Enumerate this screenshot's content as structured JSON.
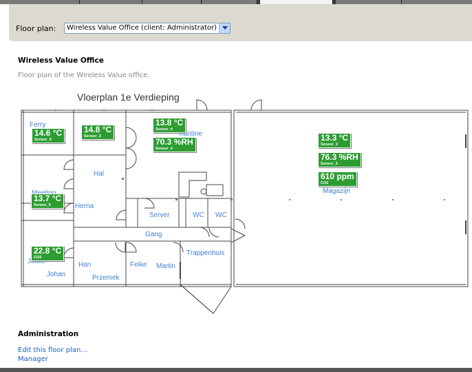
{
  "toolbar": {
    "floor_plan_label": "Floor plan:",
    "floor_plan_selected": "Wireless Value Office (client: Administrator)"
  },
  "page": {
    "title": "Wireless Value Office",
    "description": "Floor plan of the Wireless Value office."
  },
  "plan": {
    "title": "Vloerplan 1e Verdieping",
    "rooms": {
      "ferry": "Ferry",
      "kantine": "Kantine",
      "hal": "Hal",
      "meeting": "Meeting",
      "herna": "Herna",
      "server": "Server",
      "wc1": "WC",
      "wc2": "WC",
      "gang": "Gang",
      "trappenhuis": "Trappenhuis",
      "jouke": "Jouke",
      "johan": "Johan",
      "han": "Han",
      "przemek": "Przemek",
      "feike": "Feike",
      "martin": "Martin",
      "magazijn": "Magazijn"
    }
  },
  "sensors": [
    {
      "value": "14.6 °C",
      "name": "Sensor_6"
    },
    {
      "value": "14.8 °C",
      "name": "Sensor_3"
    },
    {
      "value": "13.8 °C",
      "name": "Sensor_4"
    },
    {
      "value": "70.3 %RH",
      "name": "Sensor_4"
    },
    {
      "value": "13.7 °C",
      "name": "Sensor_5"
    },
    {
      "value": "22.8 °C",
      "name": "CO2"
    },
    {
      "value": "13.3 °C",
      "name": "Sensor_2"
    },
    {
      "value": "76.3 %RH",
      "name": "Sensor_2"
    },
    {
      "value": "610 ppm",
      "name": "CO2"
    }
  ],
  "administration": {
    "title": "Administration",
    "edit_link": "Edit this floor plan...",
    "manager_link": "Manager"
  },
  "colors": {
    "sensor_green": "#2d9d32",
    "room_label_blue": "#3f7fd6",
    "link_blue": "#1b5fc0",
    "toolbar_bg": "#dcd9d0"
  }
}
